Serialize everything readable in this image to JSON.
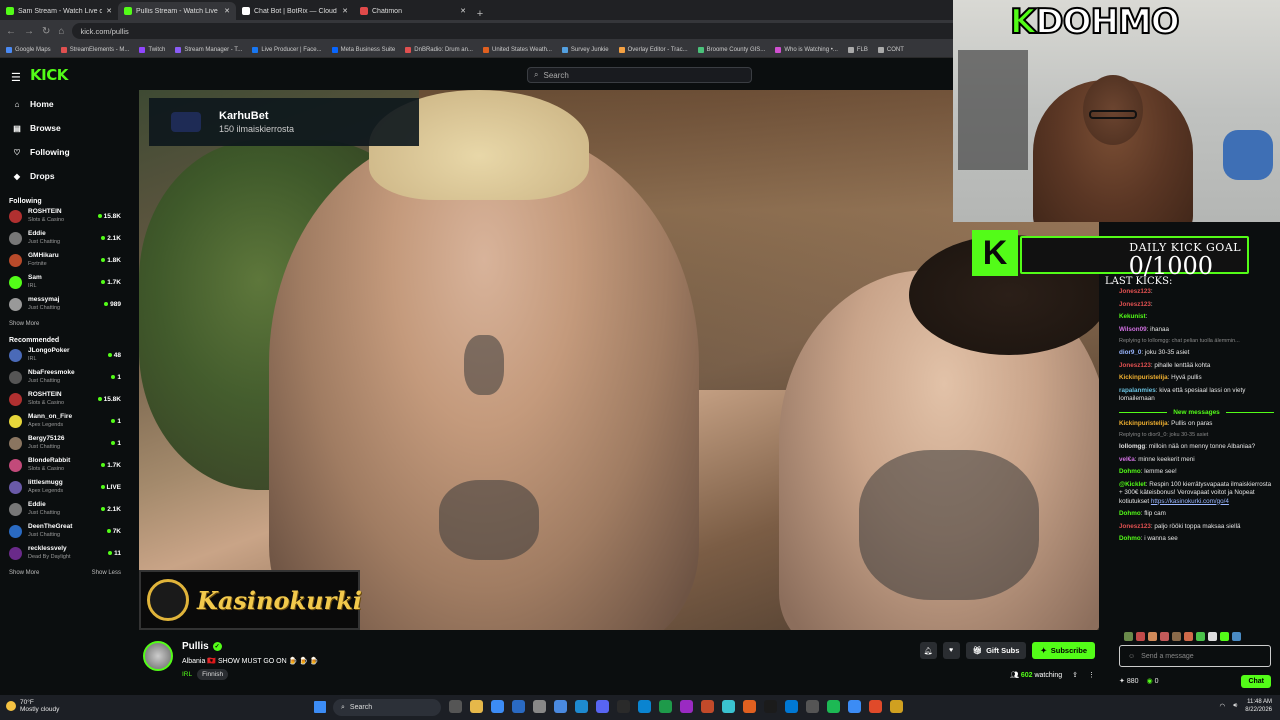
{
  "browser": {
    "tabs": [
      {
        "title": "Sam Stream - Watch Live o",
        "color": "#53fc18",
        "active": false
      },
      {
        "title": "Pullis Stream - Watch Live",
        "color": "#53fc18",
        "active": true
      },
      {
        "title": "Chat Bot | BotRix — Cloud Strea",
        "color": "#ffffff",
        "active": false
      },
      {
        "title": "Chatimon",
        "color": "#e04a4a",
        "active": false
      }
    ],
    "url": "kick.com/pullis",
    "bookmarks": [
      "Google Maps",
      "StreamElements - M...",
      "Twitch",
      "Stream Manager - T...",
      "Live Producer | Face...",
      "Meta Business Suite",
      "DnBRadio: Drum an...",
      "United States Weath...",
      "Survey Junkie",
      "Overlay Editor - Trac...",
      "Broome County GIS...",
      "Who is Watching •...",
      "FLB",
      "CONT"
    ]
  },
  "kick": {
    "logo": "KICK",
    "search_placeholder": "Search",
    "nav": [
      {
        "label": "Home",
        "icon": "⌂"
      },
      {
        "label": "Browse",
        "icon": "▤"
      },
      {
        "label": "Following",
        "icon": "♡"
      },
      {
        "label": "Drops",
        "icon": "◆"
      }
    ],
    "following_title": "Following",
    "following": [
      {
        "name": "ROSHTEIN",
        "cat": "Slots & Casino",
        "viewers": "15.8K",
        "color": "#b03030"
      },
      {
        "name": "Eddie",
        "cat": "Just Chatting",
        "viewers": "2.1K",
        "color": "#777777"
      },
      {
        "name": "GMHikaru",
        "cat": "Fortnite",
        "viewers": "1.8K",
        "color": "#b84a2a"
      },
      {
        "name": "Sam",
        "cat": "IRL",
        "viewers": "1.7K",
        "color": "#53fc18"
      },
      {
        "name": "messymaj",
        "cat": "Just Chatting",
        "viewers": "989",
        "color": "#999999"
      }
    ],
    "show_more": "Show More",
    "recommended_title": "Recommended",
    "recommended": [
      {
        "name": "JLongoPoker",
        "cat": "IRL",
        "viewers": "48",
        "color": "#4a6ab8"
      },
      {
        "name": "NbaFreesmoke",
        "cat": "Just Chatting",
        "viewers": "1",
        "color": "#555555"
      },
      {
        "name": "ROSHTEIN",
        "cat": "Slots & Casino",
        "viewers": "15.8K",
        "color": "#b03030"
      },
      {
        "name": "Mann_on_Fire",
        "cat": "Apex Legends",
        "viewers": "1",
        "color": "#e6d63a"
      },
      {
        "name": "Bergy75126",
        "cat": "Just Chatting",
        "viewers": "1",
        "color": "#8a7560"
      },
      {
        "name": "BlondeRabbit",
        "cat": "Slots & Casino",
        "viewers": "1.7K",
        "color": "#c24a7a"
      },
      {
        "name": "littlesmugg",
        "cat": "Apex Legends",
        "viewers": "LIVE",
        "color": "#6a5aa8"
      },
      {
        "name": "Eddie",
        "cat": "Just Chatting",
        "viewers": "2.1K",
        "color": "#777777"
      },
      {
        "name": "DeenTheGreat",
        "cat": "Just Chatting",
        "viewers": "7K",
        "color": "#2a6ac2"
      },
      {
        "name": "recklessvely",
        "cat": "Dead By Daylight",
        "viewers": "11",
        "color": "#6a2a8a"
      }
    ],
    "show_less": "Show Less"
  },
  "player": {
    "promo_title": "KarhuBet",
    "promo_sub": "150 ilmaiskierrosta",
    "sponsor": "Kasinokurki"
  },
  "overlay": {
    "brand": "DOHMO",
    "brand_k": "K",
    "goal_title": "DAILY KICK GOAL",
    "goal_count": "0/1000",
    "last_kicks": "LAST KICKS:"
  },
  "chat": {
    "messages": [
      {
        "type": "msg",
        "user": "Jonesz123",
        "color": "#e05050",
        "text": ""
      },
      {
        "type": "msg",
        "user": "Jonesz123",
        "color": "#e05050",
        "text": ""
      },
      {
        "type": "msg",
        "user": "Kekunist",
        "color": "#53fc18",
        "text": ""
      },
      {
        "type": "msg",
        "user": "Wilson09",
        "color": "#d070e0",
        "text": "ihanaa"
      },
      {
        "type": "reply",
        "text": "Replying to lollomgg: chat pelian tuolla älemmin..."
      },
      {
        "type": "msg",
        "user": "dior9_0",
        "color": "#9ab6ff",
        "text": "joku 30-35 asiet"
      },
      {
        "type": "msg",
        "user": "Jonesz123",
        "color": "#e05050",
        "text": "pihalle lenttää kohta"
      },
      {
        "type": "msg",
        "user": "Kickinpuristelija",
        "color": "#f0b030",
        "text": "Hyvä pullis"
      },
      {
        "type": "msg",
        "user": "rapalanmies",
        "color": "#6ac2e0",
        "text": "kiva että spesiaal lassi on viety lomailemaan"
      },
      {
        "type": "divider",
        "text": "New messages"
      },
      {
        "type": "msg",
        "user": "Kickinpuristelija",
        "color": "#f0b030",
        "text": "Pullis on paras"
      },
      {
        "type": "reply",
        "text": "Replying to dior9_0: joku 30-35 asiet"
      },
      {
        "type": "msg",
        "user": "lollomgg",
        "color": "#e0e0e0",
        "text": "milloin nää on menny tonne Albaniaa?"
      },
      {
        "type": "msg",
        "user": "vel€a",
        "color": "#d070e0",
        "text": "minne keekerit meni"
      },
      {
        "type": "msg",
        "user": "Dohmo",
        "color": "#53fc18",
        "text": "lemme see!"
      },
      {
        "type": "msg",
        "user": "@Kicklet",
        "color": "#53fc18",
        "text": "Respin 100 kierrätysvapaata ilmaiskierrosta + 300€ käteisbonus! Verovapaat voitot ja Nopeat kotiutukset",
        "link": "https://kasinokurki.com/go/4"
      },
      {
        "type": "msg",
        "user": "Dohmo",
        "color": "#53fc18",
        "text": "flip cam"
      },
      {
        "type": "msg",
        "user": "Jonesz123",
        "color": "#e05050",
        "text": "paljo rööki toppa maksaa siellä"
      },
      {
        "type": "msg",
        "user": "Dohmo",
        "color": "#53fc18",
        "text": "i wanna see"
      }
    ],
    "input_placeholder": "Send a message",
    "points": "880",
    "zero": "0",
    "chat_button": "Chat"
  },
  "stream": {
    "name": "Pullis",
    "title": "Albania 🇦🇱 SHOW MUST GO ON 🍺 🍺 🍺",
    "category": "IRL",
    "tag": "Finnish",
    "gift_subs": "Gift Subs",
    "subscribe": "Subscribe",
    "viewers": "602",
    "watching": "watching"
  },
  "taskbar": {
    "temp": "70°F",
    "weather": "Mostly cloudy",
    "search": "Search",
    "time": "11:48 AM",
    "date": "8/22/2026"
  }
}
